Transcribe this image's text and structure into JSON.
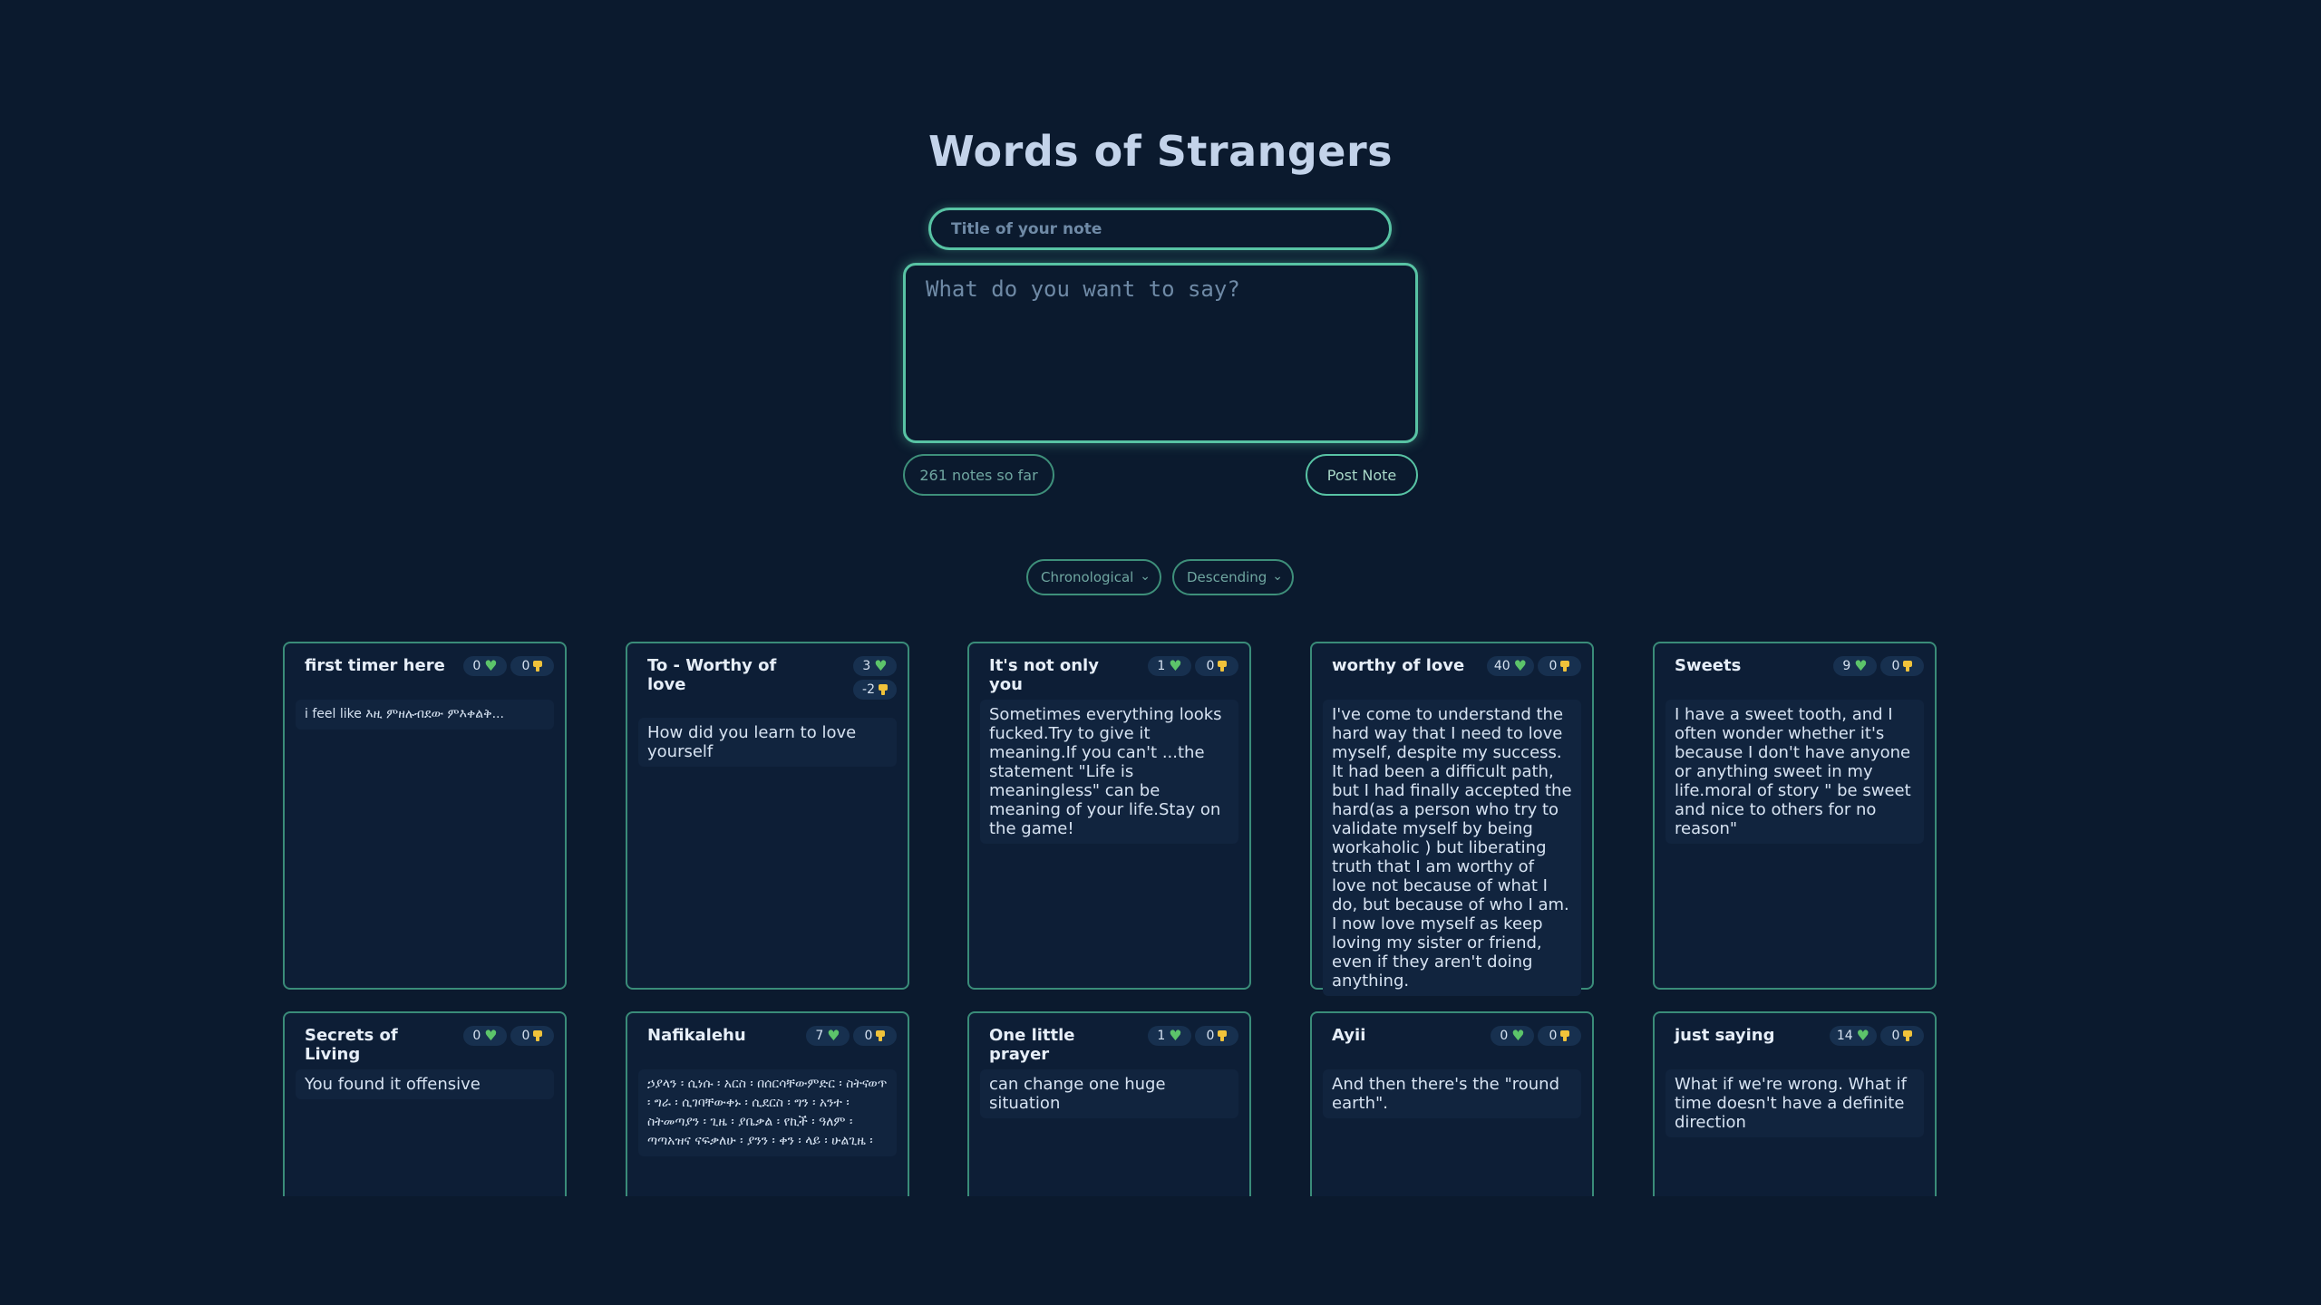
{
  "app": {
    "title": "Words of Strangers"
  },
  "composer": {
    "title_placeholder": "Title of your note",
    "body_placeholder": "What do you want to say?",
    "notes_count_label": "261 notes so far",
    "post_button_label": "Post Note"
  },
  "sorting": {
    "order_selected": "Chronological",
    "direction_selected": "Descending"
  },
  "notes": [
    {
      "title": "first timer here",
      "likes": "0",
      "dislikes": "0",
      "body": "i feel like እዚ ምዘሉብደው ምእቀልቅ..."
    },
    {
      "title": "To - Worthy of love",
      "likes": "3",
      "dislikes": "-2",
      "body": "How did you learn to love yourself"
    },
    {
      "title": "It's not only you",
      "likes": "1",
      "dislikes": "0",
      "body": "Sometimes everything looks fucked.Try to give it meaning.If you can't ...the statement \"Life is meaningless\" can be meaning of your life.Stay on the game!"
    },
    {
      "title": "worthy of love",
      "likes": "40",
      "dislikes": "0",
      "body": "I've come to understand the hard way that I need to love myself, despite my success. It had been a difficult path, but I had finally accepted the hard(as a person who try to validate myself by being workaholic ) but liberating truth that I am worthy of love not because of what I do, but because of who I am. I now love myself as keep loving my sister or friend, even if they aren't doing anything."
    },
    {
      "title": "Sweets",
      "likes": "9",
      "dislikes": "0",
      "body": "I have a sweet tooth, and I often wonder whether it's because I don't have anyone or anything sweet in my life.moral of story \" be sweet and nice to others for no reason\""
    },
    {
      "title": "Secrets of Living",
      "likes": "0",
      "dislikes": "0",
      "body": "You found it offensive"
    },
    {
      "title": "Nafikalehu",
      "likes": "7",
      "dislikes": "0",
      "body": "ኃያላን ፡ ሲነሱ ፡ አርስ ፡ በሰርሳቸውምድር ፡ ስትናወጥ ፡ ግራ ፡ ሲገባቸውቀኑ ፡ ሲደርስ ፡ ግን ፡ አንተ ፡ ስትመጣያን ፡ ጊዜ ፡ ያቤቃል ፡ የኪች ፡ ዓለም ፡ ጣጣአዝና ናፍቃለሁ ፡ ያንን ፡ ቀን ፡ ላይ ፡ ሁልጊዜ ፡"
    },
    {
      "title": "One little prayer",
      "likes": "1",
      "dislikes": "0",
      "body": "can change one huge situation"
    },
    {
      "title": "Ayii",
      "likes": "0",
      "dislikes": "0",
      "body": "And then there's the \"round earth\"."
    },
    {
      "title": "just saying",
      "likes": "14",
      "dislikes": "0",
      "body": "What if we're wrong. What if time doesn't have a definite direction"
    }
  ],
  "colors": {
    "background": "#0b1a2e",
    "accent": "#58c3a4",
    "like": "#5cc46a",
    "dislike": "#f0c23a"
  },
  "icons": {
    "like": "heart-icon",
    "dislike": "thumbs-down-icon",
    "select": "chevron-down-icon"
  }
}
